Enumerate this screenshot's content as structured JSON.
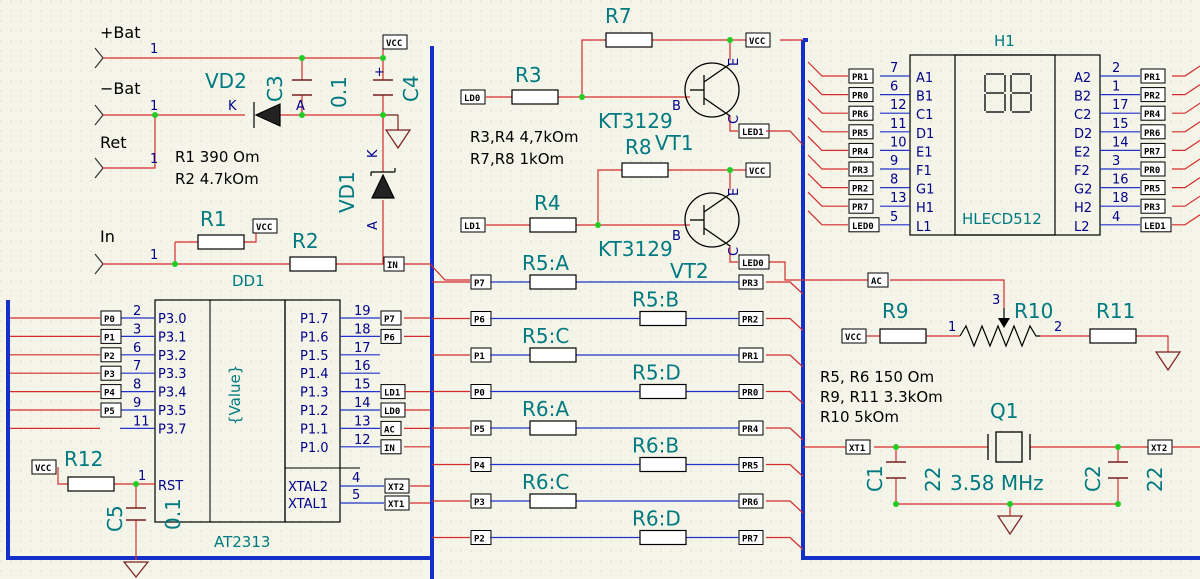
{
  "colors": {
    "background": "#f4f4e8",
    "wire": "#d42c2c",
    "net_blue": "#2233cc",
    "bus": "#1530c8",
    "component": "#7a1f1f",
    "junction": "#22cc22",
    "label": "#007a80"
  },
  "battery": {
    "plus": "+Bat",
    "minus": "−Bat",
    "ret": "Ret",
    "in": "In",
    "pin1": "1"
  },
  "components": {
    "VD2": "VD2",
    "C3": "C3",
    "C3_value": "0.1",
    "C4": "C4",
    "VD1": "VD1",
    "R1": "R1",
    "R2": "R2",
    "R3": "R3",
    "R4": "R4",
    "R7": "R7",
    "R8": "R8",
    "VT1_model": "KT3129",
    "VT1": "VT1",
    "VT2_model": "KT3129",
    "VT2": "VT2",
    "DD1": "DD1",
    "AT2313": "AT2313",
    "value_placeholder": "{Value}",
    "R12": "R12",
    "C5": "C5",
    "C5_value": "0.1",
    "H1": "H1",
    "HLECD512": "HLECD512",
    "R9": "R9",
    "R10": "R10",
    "R11": "R11",
    "Q1": "Q1",
    "Q1_freq": "3.58 MHz",
    "C1": "C1",
    "C1_value": "22",
    "C2": "C2",
    "C2_value": "22",
    "K": "K",
    "A": "A",
    "B": "B",
    "C": "C",
    "E": "E",
    "plus": "+"
  },
  "notes": {
    "r1": "R1 390 Om",
    "r2": "R2 4.7kOm",
    "r34": "R3,R4 4,7kOm",
    "r78": "R7,R8 1kOm",
    "r56": "R5, R6 150 Om",
    "r911": "R9, R11 3.3kOm",
    "r10": "R10 5kOm"
  },
  "resistor_array": [
    "R5:A",
    "R5:B",
    "R5:C",
    "R5:D",
    "R6:A",
    "R6:B",
    "R6:C",
    "R6:D"
  ],
  "mcu_left_pins": [
    {
      "port": "P0",
      "num": "2",
      "name": "P3.0"
    },
    {
      "port": "P1",
      "num": "3",
      "name": "P3.1"
    },
    {
      "port": "P2",
      "num": "6",
      "name": "P3.2"
    },
    {
      "port": "P3",
      "num": "7",
      "name": "P3.3"
    },
    {
      "port": "P4",
      "num": "8",
      "name": "P3.4"
    },
    {
      "port": "P5",
      "num": "9",
      "name": "P3.5"
    },
    {
      "port": "",
      "num": "11",
      "name": "P3.7"
    }
  ],
  "mcu_right_pins": [
    {
      "port": "P7",
      "num": "19",
      "name": "P1.7"
    },
    {
      "port": "P6",
      "num": "18",
      "name": "P1.6"
    },
    {
      "port": "",
      "num": "17",
      "name": "P1.5"
    },
    {
      "port": "",
      "num": "16",
      "name": "P1.4"
    },
    {
      "port": "LD1",
      "num": "15",
      "name": "P1.3"
    },
    {
      "port": "LD0",
      "num": "14",
      "name": "P1.2"
    },
    {
      "port": "AC",
      "num": "13",
      "name": "P1.1"
    },
    {
      "port": "IN",
      "num": "12",
      "name": "P1.0"
    }
  ],
  "mcu_rst": {
    "num": "1",
    "name": "RST"
  },
  "mcu_xtal": [
    {
      "port": "XT2",
      "num": "4",
      "name": "XTAL2"
    },
    {
      "port": "XT1",
      "num": "5",
      "name": "XTAL1"
    }
  ],
  "mid_left_ports": [
    "P7",
    "P6",
    "P1",
    "P0",
    "P5",
    "P4",
    "P3",
    "P2"
  ],
  "mid_right_ports": [
    "PR3",
    "PR2",
    "PR1",
    "PR0",
    "PR4",
    "PR5",
    "PR6",
    "PR7"
  ],
  "display_left": [
    {
      "port": "PR1",
      "num": "7",
      "name": "A1"
    },
    {
      "port": "PR0",
      "num": "6",
      "name": "B1"
    },
    {
      "port": "PR6",
      "num": "12",
      "name": "C1"
    },
    {
      "port": "PR5",
      "num": "11",
      "name": "D1"
    },
    {
      "port": "PR4",
      "num": "10",
      "name": "E1"
    },
    {
      "port": "PR3",
      "num": "9",
      "name": "F1"
    },
    {
      "port": "PR2",
      "num": "8",
      "name": "G1"
    },
    {
      "port": "PR7",
      "num": "13",
      "name": "H1"
    },
    {
      "port": "LED0",
      "num": "5",
      "name": "L1"
    }
  ],
  "display_right": [
    {
      "port": "PR1",
      "num": "2",
      "name": "A2"
    },
    {
      "port": "PR2",
      "num": "1",
      "name": "B2"
    },
    {
      "port": "PR4",
      "num": "17",
      "name": "C2"
    },
    {
      "port": "PR6",
      "num": "15",
      "name": "D2"
    },
    {
      "port": "PR7",
      "num": "14",
      "name": "E2"
    },
    {
      "port": "PR0",
      "num": "3",
      "name": "F2"
    },
    {
      "port": "PR5",
      "num": "16",
      "name": "G2"
    },
    {
      "port": "PR3",
      "num": "18",
      "name": "H2"
    },
    {
      "port": "LED1",
      "num": "4",
      "name": "L2"
    }
  ],
  "ports": {
    "VCC": "VCC",
    "LD0": "LD0",
    "LD1": "LD1",
    "LED0": "LED0",
    "LED1": "LED1",
    "IN": "IN",
    "AC": "AC",
    "XT1": "XT1",
    "XT2": "XT2",
    "PR3": "PR3"
  },
  "pot": {
    "pin1": "1",
    "pin2": "2",
    "pin3": "3"
  }
}
